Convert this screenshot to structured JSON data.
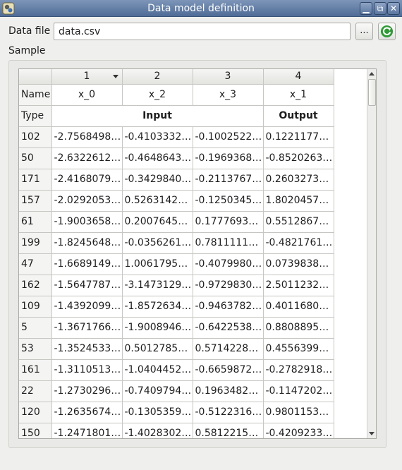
{
  "window": {
    "title": "Data model definition",
    "buttons": {
      "minimize": "▁",
      "maximize": "⧉",
      "close": "✕"
    }
  },
  "data_file": {
    "label": "Data file",
    "value": "data.csv",
    "browse_label": "...",
    "reload_icon": "reload-icon"
  },
  "sample": {
    "label": "Sample",
    "table": {
      "columns": [
        "1",
        "2",
        "3",
        "4"
      ],
      "name_row": {
        "header": "Name",
        "values": [
          "x_0",
          "x_2",
          "x_3",
          "x_1"
        ]
      },
      "type_row": {
        "header": "Type",
        "input": "Input",
        "output": "Output"
      },
      "rows": [
        {
          "id": "102",
          "values": [
            "-2.7568498…",
            "-0.4103332…",
            "-0.1002522…",
            "0.1221177…"
          ]
        },
        {
          "id": "50",
          "values": [
            "-2.6322612…",
            "-0.4648643…",
            "-0.1969368…",
            "-0.8520263…"
          ]
        },
        {
          "id": "171",
          "values": [
            "-2.4168079…",
            "-0.3429840…",
            "-0.2113767…",
            "0.2603273…"
          ]
        },
        {
          "id": "157",
          "values": [
            "-2.0292053…",
            "0.5263142…",
            "-0.1250345…",
            "1.8020457…"
          ]
        },
        {
          "id": "61",
          "values": [
            "-1.9003658…",
            "0.2007645…",
            "0.1777693…",
            "0.5512867…"
          ]
        },
        {
          "id": "199",
          "values": [
            "-1.8245648…",
            "-0.0356261…",
            "0.7811111…",
            "-0.4821761…"
          ]
        },
        {
          "id": "47",
          "values": [
            "-1.6689149…",
            "1.0061795…",
            "-0.4079980…",
            "0.0739838…"
          ]
        },
        {
          "id": "162",
          "values": [
            "-1.5647787…",
            "-3.1473129…",
            "-0.9729830…",
            "2.5011232…"
          ]
        },
        {
          "id": "109",
          "values": [
            "-1.4392099…",
            "-1.8572634…",
            "-0.9463782…",
            "0.4011680…"
          ]
        },
        {
          "id": "5",
          "values": [
            "-1.3671766…",
            "-1.9008946…",
            "-0.6422538…",
            "0.8808895…"
          ]
        },
        {
          "id": "53",
          "values": [
            "-1.3524533…",
            "0.5012785…",
            "0.5714228…",
            "0.4556399…"
          ]
        },
        {
          "id": "161",
          "values": [
            "-1.3110513…",
            "-1.0404452…",
            "-0.6659872…",
            "-0.2782918…"
          ]
        },
        {
          "id": "22",
          "values": [
            "-1.2730296…",
            "-0.7409794…",
            "0.1963482…",
            "-0.1147202…"
          ]
        },
        {
          "id": "120",
          "values": [
            "-1.2635674…",
            "-0.1305359…",
            "-0.5122316…",
            "0.9801153…"
          ]
        },
        {
          "id": "150",
          "values": [
            "-1.2471801…",
            "-1.4028302…",
            "0.5812215…",
            "-0.4209233…"
          ]
        }
      ]
    }
  }
}
